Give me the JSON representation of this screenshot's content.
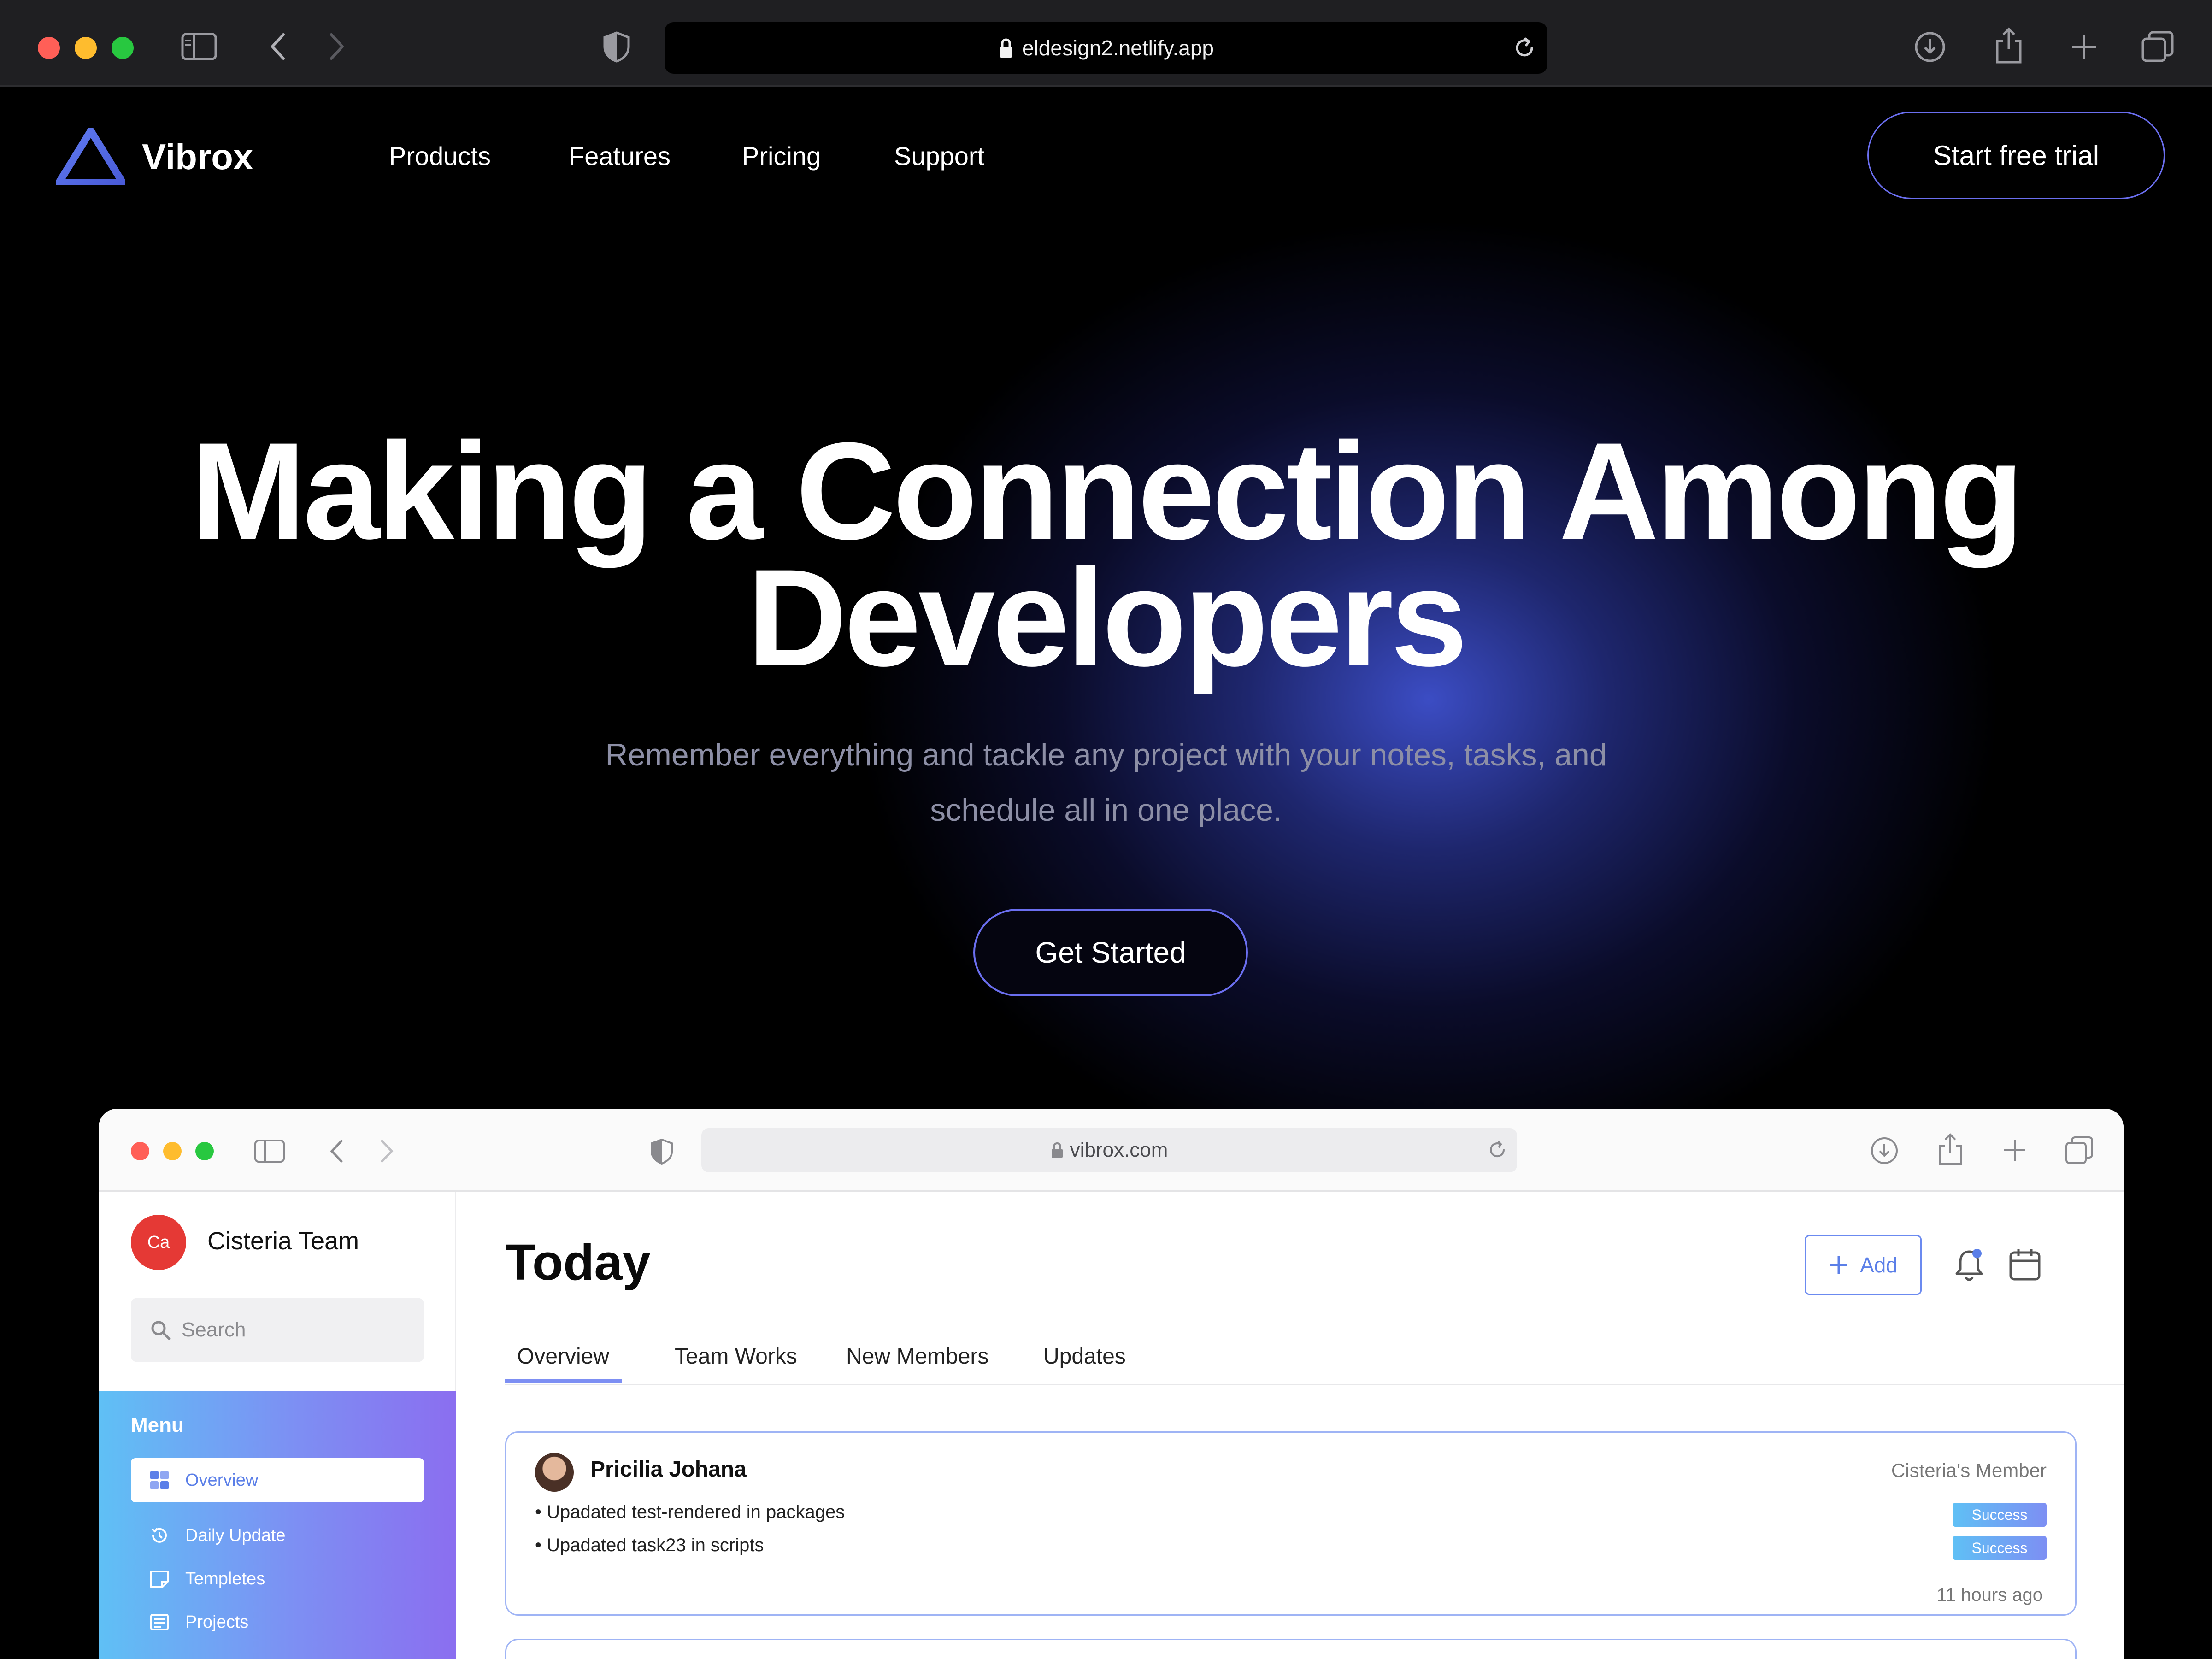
{
  "browser": {
    "url": "eldesign2.netlify.app",
    "icons": [
      "sidebar-icon",
      "back-icon",
      "forward-icon",
      "shield-icon",
      "lock-icon",
      "reload-icon",
      "download-icon",
      "share-icon",
      "new-tab-icon",
      "tabs-overview-icon"
    ]
  },
  "site": {
    "brand": "Vibrox",
    "nav": [
      "Products",
      "Features",
      "Pricing",
      "Support"
    ],
    "cta_trial": "Start free trial",
    "hero_title_line1": "Making a Connection Among",
    "hero_title_line2": "Developers",
    "hero_subtitle_line1": "Remember everything and tackle any project with your notes, tasks, and",
    "hero_subtitle_line2": "schedule all in one place.",
    "cta_start": "Get Started",
    "colors": {
      "accent": "#6b6ff0",
      "glow": "#4a5ae6",
      "background": "#000000"
    }
  },
  "preview": {
    "url": "vibrox.com",
    "team_initials": "Ca",
    "team_name": "Cisteria Team",
    "search_placeholder": "Search",
    "menu_title": "Menu",
    "menu_items": [
      "Overview",
      "Daily Update",
      "Templetes",
      "Projects"
    ],
    "page_title": "Today",
    "add_label": "Add",
    "tabs": [
      "Overview",
      "Team Works",
      "New Members",
      "Updates"
    ],
    "card": {
      "name": "Pricilia Johana",
      "role": "Cisteria's Member",
      "updates": [
        "Upadated test-rendered in packages",
        "Upadated task23 in scripts"
      ],
      "badges": [
        "Success",
        "Success"
      ],
      "time": "11 hours ago"
    }
  }
}
